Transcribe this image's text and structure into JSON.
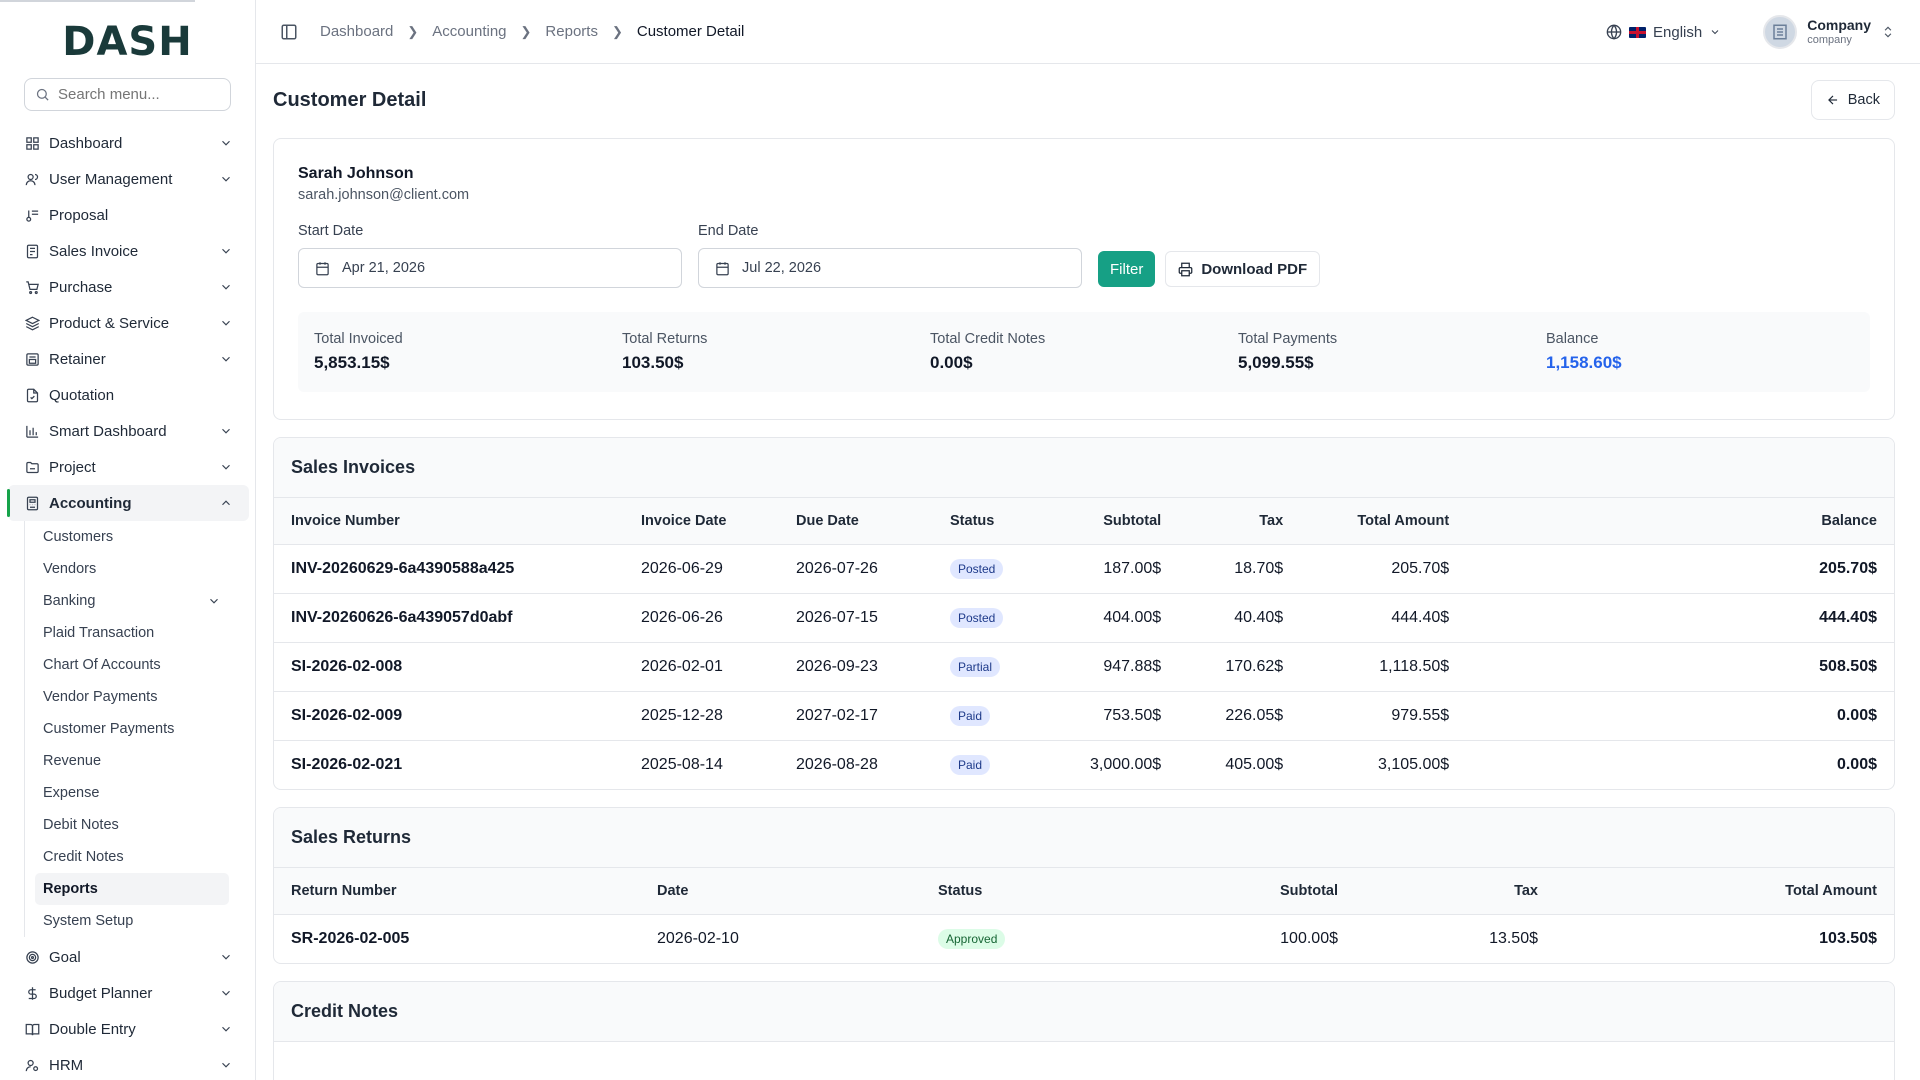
{
  "app": {
    "logo_text": "DASH"
  },
  "search": {
    "placeholder": "Search menu..."
  },
  "sidebar": {
    "items": [
      {
        "label": "Dashboard",
        "icon": "grid-icon",
        "has_children": true
      },
      {
        "label": "User Management",
        "icon": "users-icon",
        "has_children": true
      },
      {
        "label": "Proposal",
        "icon": "proposal-icon",
        "has_children": false
      },
      {
        "label": "Sales Invoice",
        "icon": "invoice-icon",
        "has_children": true
      },
      {
        "label": "Purchase",
        "icon": "cart-icon",
        "has_children": true
      },
      {
        "label": "Product & Service",
        "icon": "layers-icon",
        "has_children": true
      },
      {
        "label": "Retainer",
        "icon": "retainer-icon",
        "has_children": true
      },
      {
        "label": "Quotation",
        "icon": "quotation-icon",
        "has_children": false
      },
      {
        "label": "Smart Dashboard",
        "icon": "bar-chart-icon",
        "has_children": true
      },
      {
        "label": "Project",
        "icon": "folder-icon",
        "has_children": true
      },
      {
        "label": "Accounting",
        "icon": "calculator-icon",
        "has_children": true,
        "expanded": true
      }
    ],
    "accounting_children": [
      {
        "label": "Customers"
      },
      {
        "label": "Vendors"
      },
      {
        "label": "Banking",
        "has_children": true
      },
      {
        "label": "Plaid Transaction"
      },
      {
        "label": "Chart Of Accounts"
      },
      {
        "label": "Vendor Payments"
      },
      {
        "label": "Customer Payments"
      },
      {
        "label": "Revenue"
      },
      {
        "label": "Expense"
      },
      {
        "label": "Debit Notes"
      },
      {
        "label": "Credit Notes"
      },
      {
        "label": "Reports",
        "active": true
      },
      {
        "label": "System Setup"
      }
    ],
    "items_after": [
      {
        "label": "Goal",
        "icon": "target-icon",
        "has_children": true
      },
      {
        "label": "Budget Planner",
        "icon": "dollar-icon",
        "has_children": true
      },
      {
        "label": "Double Entry",
        "icon": "book-icon",
        "has_children": true
      },
      {
        "label": "HRM",
        "icon": "hrm-icon",
        "has_children": true
      }
    ]
  },
  "header": {
    "breadcrumbs": [
      "Dashboard",
      "Accounting",
      "Reports",
      "Customer Detail"
    ],
    "language": "English",
    "company_name": "Company",
    "company_sub": "company"
  },
  "page": {
    "title": "Customer Detail",
    "back_label": "Back"
  },
  "customer": {
    "name": "Sarah Johnson",
    "email": "sarah.johnson@client.com"
  },
  "filters": {
    "start_label": "Start Date",
    "start_value": "Apr 21, 2026",
    "end_label": "End Date",
    "end_value": "Jul 22, 2026",
    "filter_label": "Filter",
    "pdf_label": "Download PDF"
  },
  "summary": [
    {
      "label": "Total Invoiced",
      "value": "5,853.15$"
    },
    {
      "label": "Total Returns",
      "value": "103.50$"
    },
    {
      "label": "Total Credit Notes",
      "value": "0.00$"
    },
    {
      "label": "Total Payments",
      "value": "5,099.55$"
    },
    {
      "label": "Balance",
      "value": "1,158.60$"
    }
  ],
  "sales_invoices": {
    "title": "Sales Invoices",
    "columns": [
      "Invoice Number",
      "Invoice Date",
      "Due Date",
      "Status",
      "Subtotal",
      "Tax",
      "Total Amount",
      "Balance"
    ],
    "rows": [
      {
        "number": "INV-20260629-6a4390588a425",
        "date": "2026-06-29",
        "due": "2026-07-26",
        "status": "Posted",
        "subtotal": "187.00$",
        "tax": "18.70$",
        "total": "205.70$",
        "balance": "205.70$"
      },
      {
        "number": "INV-20260626-6a439057d0abf",
        "date": "2026-06-26",
        "due": "2026-07-15",
        "status": "Posted",
        "subtotal": "404.00$",
        "tax": "40.40$",
        "total": "444.40$",
        "balance": "444.40$"
      },
      {
        "number": "SI-2026-02-008",
        "date": "2026-02-01",
        "due": "2026-09-23",
        "status": "Partial",
        "subtotal": "947.88$",
        "tax": "170.62$",
        "total": "1,118.50$",
        "balance": "508.50$"
      },
      {
        "number": "SI-2026-02-009",
        "date": "2025-12-28",
        "due": "2027-02-17",
        "status": "Paid",
        "subtotal": "753.50$",
        "tax": "226.05$",
        "total": "979.55$",
        "balance": "0.00$"
      },
      {
        "number": "SI-2026-02-021",
        "date": "2025-08-14",
        "due": "2026-08-28",
        "status": "Paid",
        "subtotal": "3,000.00$",
        "tax": "405.00$",
        "total": "3,105.00$",
        "balance": "0.00$"
      }
    ]
  },
  "sales_returns": {
    "title": "Sales Returns",
    "columns": [
      "Return Number",
      "Date",
      "Status",
      "Subtotal",
      "Tax",
      "Total Amount"
    ],
    "rows": [
      {
        "number": "SR-2026-02-005",
        "date": "2026-02-10",
        "status": "Approved",
        "subtotal": "100.00$",
        "tax": "13.50$",
        "total": "103.50$"
      }
    ]
  },
  "credit_notes": {
    "title": "Credit Notes"
  },
  "colors": {
    "accent": "#16a085",
    "active_bar": "#16a34a",
    "balance_blue": "#2563eb"
  }
}
